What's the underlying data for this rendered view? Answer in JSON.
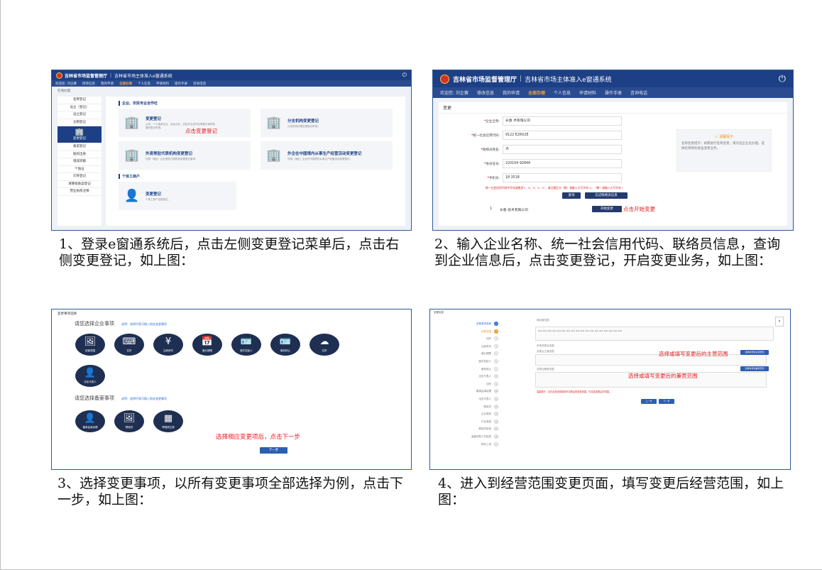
{
  "captions": {
    "c1": "1、登录e窗通系统后，点击左侧变更登记菜单后，点击右侧变更登记，如上图：",
    "c2": "2、输入企业名称、统一社会信用代码、联络员信息，查询到企业信息后，点击变更登记，开启变更业务，如上图：",
    "c3": "3、选择变更事项，以所有变更事项全部选择为例，点击下一步，如上图：",
    "c4": "4、进入到经营范围变更页面，填写变更后经营范围，如上图："
  },
  "app": {
    "dept": "吉林省市场监督管理厅",
    "system": "吉林省市场主体准入e窗通系统",
    "power_icon": "⏻",
    "user": "欢迎您: 刘企赛",
    "pwd": "修改信息",
    "nav": [
      "我的申请",
      "全部办理",
      "个人信息",
      "申请材料",
      "操作手册",
      "咨询电话"
    ],
    "nav_active_index": 1
  },
  "panel1": {
    "crumb": "在线办理",
    "side": [
      "名称登记",
      "设立（登记）",
      "设立登记",
      "注销登记",
      "变更登记",
      "备案登记",
      "股权出质",
      "增减资额",
      "个独业",
      "迁移登记",
      "清算组备案登记",
      "营业执照注销"
    ],
    "side_selected_index": 4,
    "section1": "企业、农民专业合作社",
    "section2": "个体工商户",
    "cards": [
      {
        "title": "变更登记",
        "desc": "公司、个人独资企业、合伙企业、农民专业合作社等登记事项变更的登记申请。"
      },
      {
        "title": "分支机构变更登记",
        "desc": "分支机构办理变更登记申请。"
      },
      {
        "title": "外资常驻代表机构变更登记",
        "desc": "外国（地区）企业常驻代表机构变更登记事项。"
      },
      {
        "title": "外企在中国境内从事生产经营活动变更登记",
        "desc": "外国（地区）企业在中国境内从事生产经营活动变更登记。"
      }
    ],
    "card_getihu": {
      "title": "变更登记",
      "desc": "个体工商户变更登记。"
    },
    "note": "点击变更登记"
  },
  "panel2": {
    "title": "变更",
    "fields": [
      {
        "label": "企业全称:",
        "value": "长春          术有限公司"
      },
      {
        "label": "统一社会信用代码:",
        "value": "9122          E2RX2E"
      },
      {
        "label": "联络员姓名:",
        "value": "许"
      },
      {
        "label": "身份证号:",
        "value": "220104          92844"
      },
      {
        "label": "手机号:",
        "value": "18          3518"
      }
    ],
    "warn": "统一社会信用代码中字母请使用“I、O、Z、S、V”，请注意区分（数）请输入大写字母 O，（数）请输入大写字母 I",
    "query_btn": "查询",
    "remember_btn": "忘记联络员信息",
    "tip_title": "温馨提示",
    "tip_body": "名称变更提示：如需进行名称变更，请点击企业名办理，选择名称预先核准变更业务。",
    "row_index": "1",
    "row_name": "长春          技术有限公司",
    "start_btn": "开始变更",
    "note": "点击开始变更"
  },
  "panel3": {
    "header": "变更事项选择",
    "q1": "请您选择企业事项",
    "q1_hint": "说明：选择代表可跳入相关变更事项",
    "items1": [
      {
        "icon": "🖼",
        "label": "经营范围"
      },
      {
        "icon": "⌨",
        "label": "住所"
      },
      {
        "icon": "¥",
        "label": "注册资本"
      },
      {
        "icon": "📅",
        "label": "营业期限"
      },
      {
        "icon": "🪪",
        "label": "股东发起人"
      },
      {
        "icon": "🪪",
        "label": "股权转让"
      },
      {
        "icon": "☁",
        "label": "住所"
      },
      {
        "icon": "👤",
        "label": "法定代表人"
      }
    ],
    "q2": "请您选择备案事项",
    "q2_hint": "说明：选择代表可跳入相关变更事项",
    "items2": [
      {
        "icon": "👤",
        "label": "董事监事经理"
      },
      {
        "icon": "🖼",
        "label": "联络员"
      },
      {
        "icon": "▦",
        "label": "章程修正案"
      }
    ],
    "note": "选择相应变更项后，点击下一步",
    "next_btn": "下一步"
  },
  "panel4": {
    "header": "变更信息",
    "steps": [
      "变更事项选择",
      "经营范围",
      "住所",
      "注册资本",
      "营业期限",
      "股东发起人",
      "股权转让",
      "法定代表人",
      "住所",
      "董事监事经理",
      "法定代表人",
      "联络员",
      "企业类型",
      "行业类型",
      "联络员信息",
      "高管任职人员信息",
      "附件上传"
    ],
    "current_step_index": 1,
    "orig_label": "原经营范围",
    "new_label": "申请变更后范围",
    "main_label": "变更后主营范围",
    "side_label": "变更后兼营范围",
    "btn_main": "选择并添加主营范围",
    "btn_side": "选择并添加兼营范围",
    "note1": "选择或填写变更后的主营范围",
    "note2": "选择或填写变更后的兼营范围",
    "warn": "温馨提示：请在此处选择或填写变更后的经营范围，仅包括变更后的范围。",
    "prev_btn": "上一步",
    "next_btn": "下一步"
  }
}
